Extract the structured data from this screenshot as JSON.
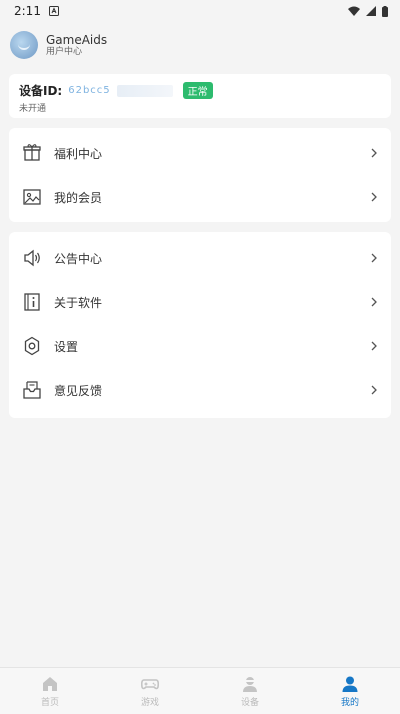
{
  "status_bar": {
    "time": "2:11"
  },
  "header": {
    "app_name": "GameAids",
    "subtitle": "用户中心"
  },
  "device": {
    "label": "设备ID:",
    "id_value": "62bcc5",
    "badge": "正常",
    "status": "未开通"
  },
  "menu_group_1": [
    {
      "label": "福利中心",
      "icon": "gift-icon"
    },
    {
      "label": "我的会员",
      "icon": "member-card-icon"
    }
  ],
  "menu_group_2": [
    {
      "label": "公告中心",
      "icon": "speaker-icon"
    },
    {
      "label": "关于软件",
      "icon": "info-icon"
    },
    {
      "label": "设置",
      "icon": "gear-icon"
    },
    {
      "label": "意见反馈",
      "icon": "feedback-icon"
    }
  ],
  "tabbar": [
    {
      "label": "首页",
      "icon": "home-icon",
      "active": false
    },
    {
      "label": "游戏",
      "icon": "gamepad-icon",
      "active": false
    },
    {
      "label": "设备",
      "icon": "device-icon",
      "active": false
    },
    {
      "label": "我的",
      "icon": "user-icon",
      "active": true
    }
  ],
  "colors": {
    "accent": "#1677c6",
    "badge": "#2dbb6e",
    "background": "#f4f4f4"
  }
}
